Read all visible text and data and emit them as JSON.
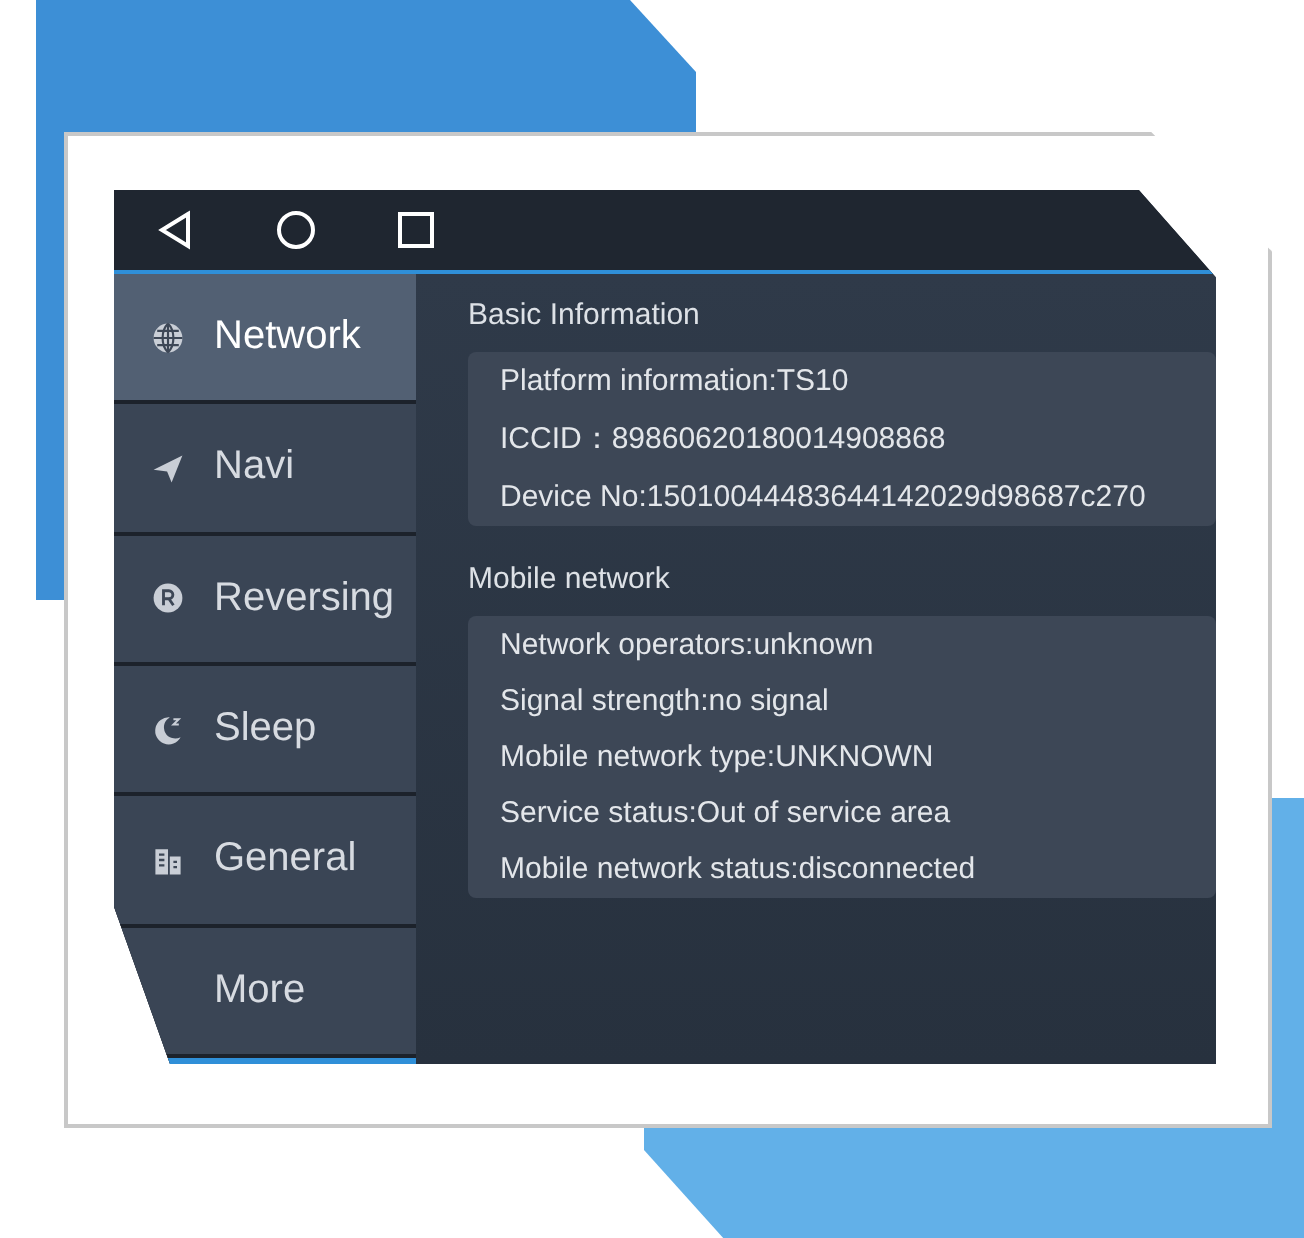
{
  "sidebar": {
    "items": [
      {
        "label": "Network",
        "selected": true
      },
      {
        "label": "Navi",
        "selected": false
      },
      {
        "label": "Reversing",
        "selected": false
      },
      {
        "label": "Sleep",
        "selected": false
      },
      {
        "label": "General",
        "selected": false
      },
      {
        "label": "More",
        "selected": false
      }
    ]
  },
  "sections": [
    {
      "title": "Basic Information",
      "lines": [
        "Platform information:TS10",
        "ICCID：89860620180014908868",
        "Device No:15010044483644142029d98687c270"
      ]
    },
    {
      "title": "Mobile network",
      "lines": [
        "Network operators:unknown",
        "Signal strength:no signal",
        "Mobile network type:UNKNOWN",
        "Service status:Out of service area",
        "Mobile network status:disconnected"
      ]
    }
  ]
}
